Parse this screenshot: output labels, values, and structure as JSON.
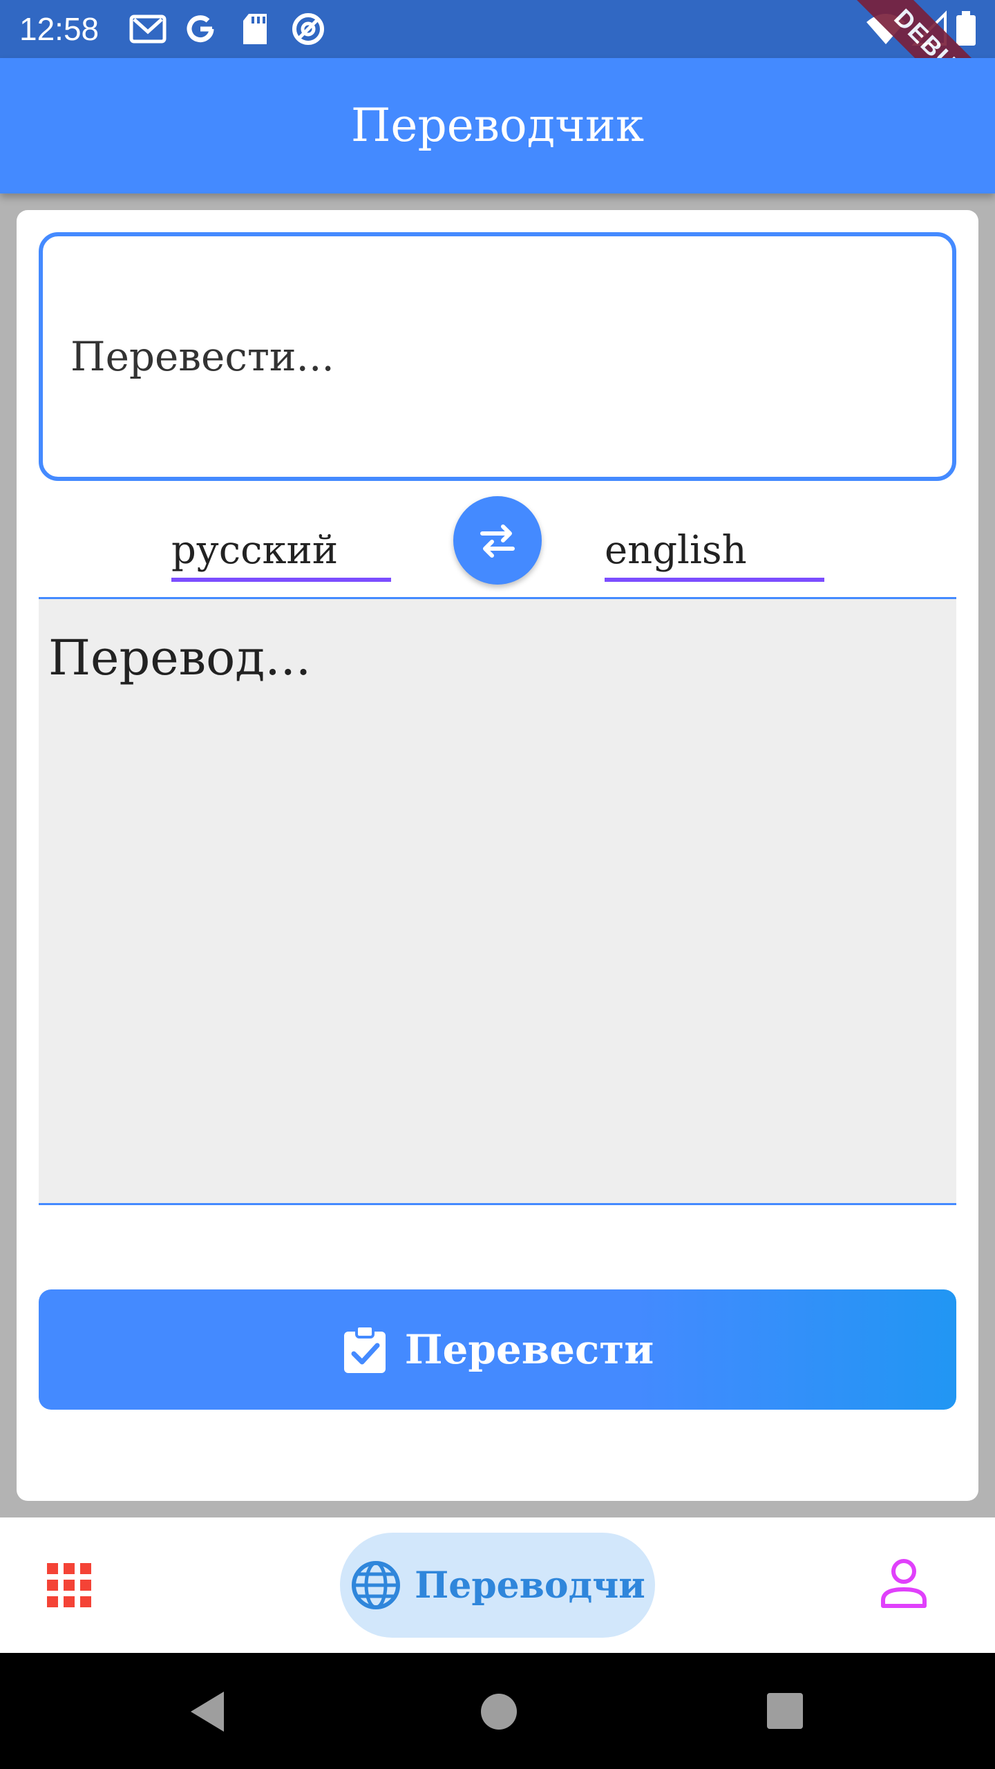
{
  "status_bar": {
    "time": "12:58",
    "icons": [
      "gmail-icon",
      "google-icon",
      "sd-card-icon",
      "no-disturb-icon",
      "wifi-icon",
      "signal-icon",
      "battery-icon"
    ],
    "debug_label": "DEBUG",
    "color": "#3168c3"
  },
  "app_bar": {
    "title": "Переводчик",
    "color": "#448aff"
  },
  "translator": {
    "source_placeholder": "Перевести...",
    "source_language": "русский",
    "target_language": "english",
    "swap_icon": "swap-icon",
    "output_placeholder": "Перевод...",
    "translate_button_label": "Перевести",
    "translate_button_icon": "clipboard-check-icon"
  },
  "bottom_nav": {
    "items": [
      {
        "icon": "apps-grid-icon",
        "color": "#f44336"
      },
      {
        "icon": "globe-icon",
        "label": "Переводчи",
        "color": "#2f86db",
        "active": true
      },
      {
        "icon": "person-icon",
        "color": "#e040fb"
      }
    ]
  },
  "colors": {
    "accent": "#448aff",
    "underline": "#7c4dff",
    "output_bg": "#eeeeee"
  }
}
